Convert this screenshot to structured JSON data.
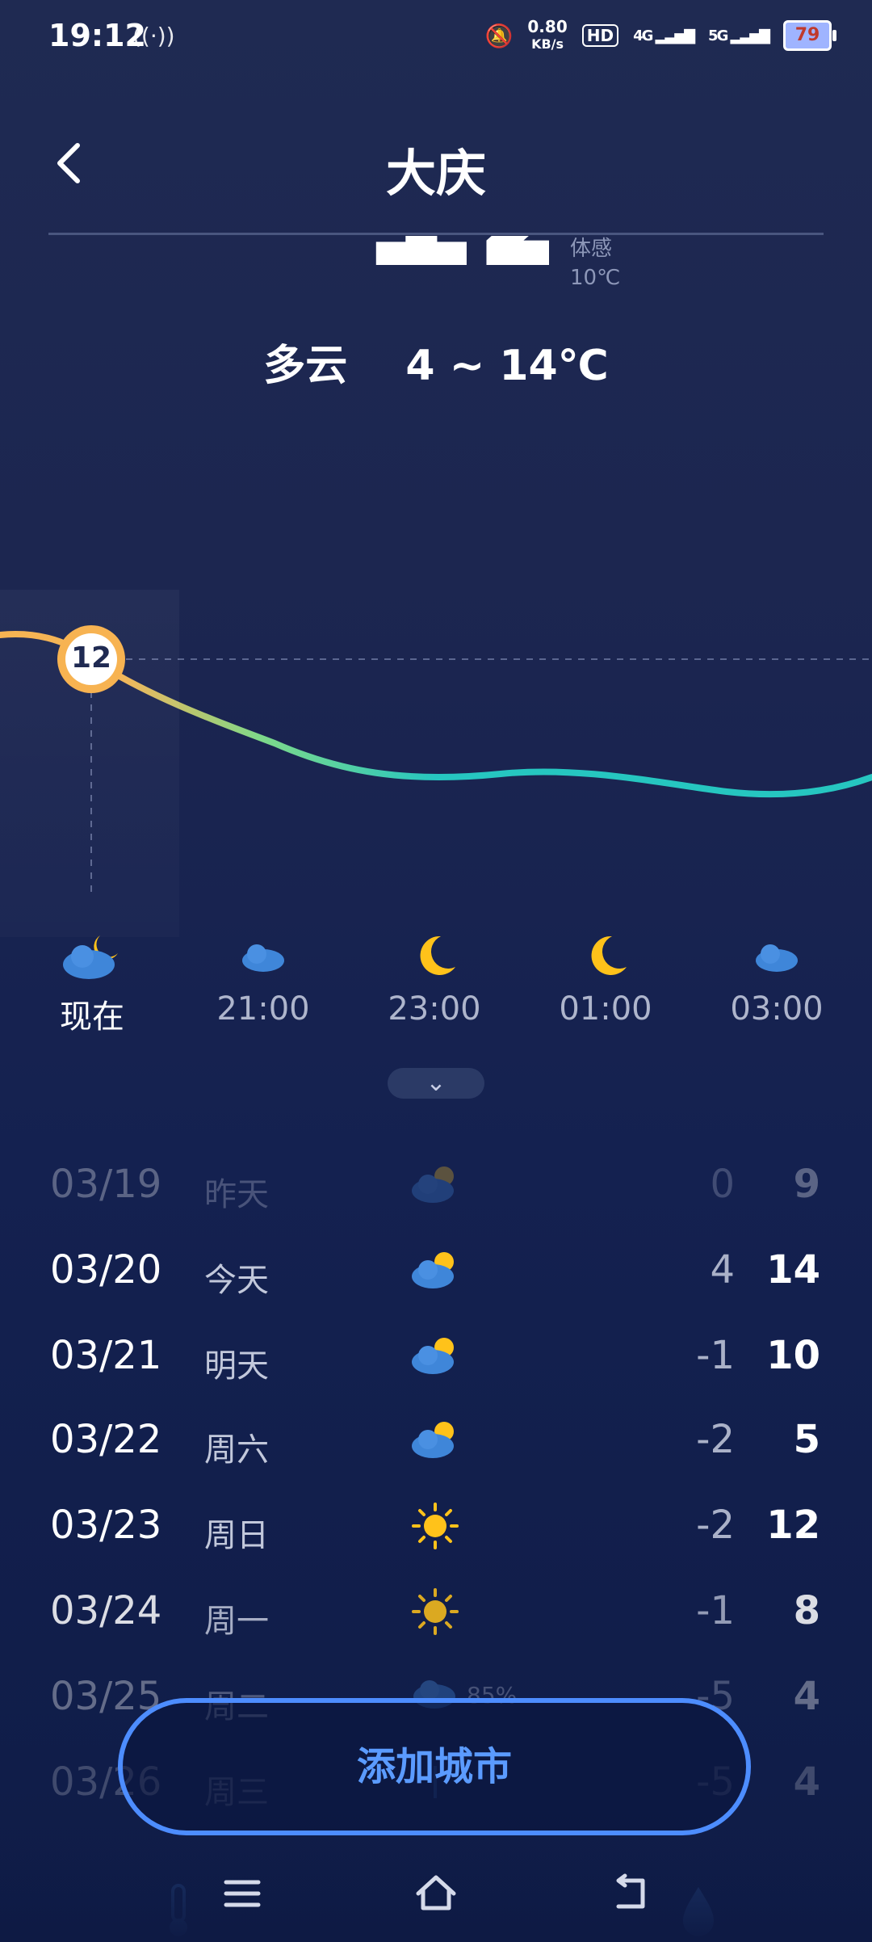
{
  "status_bar": {
    "time": "19:12",
    "net_speed_value": "0.80",
    "net_speed_unit": "KB/s",
    "hd": "HD",
    "signal1": "4G",
    "signal2": "5G",
    "battery": "79"
  },
  "header": {
    "city": "大庆"
  },
  "current": {
    "temp": "12",
    "feels_label": "体感",
    "feels_value": "10℃",
    "condition": "多云",
    "range": "4 ~ 14℃"
  },
  "chart_marker": "12",
  "hourly": [
    {
      "label": "现在",
      "icon": "cloudy-night-icon"
    },
    {
      "label": "21:00",
      "icon": "cloud-icon"
    },
    {
      "label": "23:00",
      "icon": "moon-icon"
    },
    {
      "label": "01:00",
      "icon": "moon-icon"
    },
    {
      "label": "03:00",
      "icon": "cloud-icon"
    }
  ],
  "expand_icon": "chevron-down-icon",
  "daily": [
    {
      "date": "03/19",
      "day": "昨天",
      "icon": "partly-cloudy-icon",
      "low": "0",
      "high": "9"
    },
    {
      "date": "03/20",
      "day": "今天",
      "icon": "partly-cloudy-icon",
      "low": "4",
      "high": "14"
    },
    {
      "date": "03/21",
      "day": "明天",
      "icon": "partly-cloudy-icon",
      "low": "-1",
      "high": "10"
    },
    {
      "date": "03/22",
      "day": "周六",
      "icon": "partly-cloudy-icon",
      "low": "-2",
      "high": "5"
    },
    {
      "date": "03/23",
      "day": "周日",
      "icon": "sun-icon",
      "low": "-2",
      "high": "12"
    },
    {
      "date": "03/24",
      "day": "周一",
      "icon": "sun-icon",
      "low": "-1",
      "high": "8"
    },
    {
      "date": "03/25",
      "day": "周二",
      "icon": "rain-cloud-icon",
      "pct": "85%",
      "low": "-5",
      "high": "4"
    },
    {
      "date": "03/26",
      "day": "周三",
      "icon": "rain-icon",
      "low": "-5",
      "high": "4"
    }
  ],
  "add_city_label": "添加城市",
  "nav": {
    "menu_icon": "menu-icon",
    "home_icon": "home-icon",
    "back_icon": "back-icon"
  },
  "colors": {
    "accent": "#4d8dff",
    "curve_start": "#f7b04b",
    "curve_mid": "#7ed98a",
    "curve_end": "#26c6c0",
    "sun": "#ffc21a"
  }
}
